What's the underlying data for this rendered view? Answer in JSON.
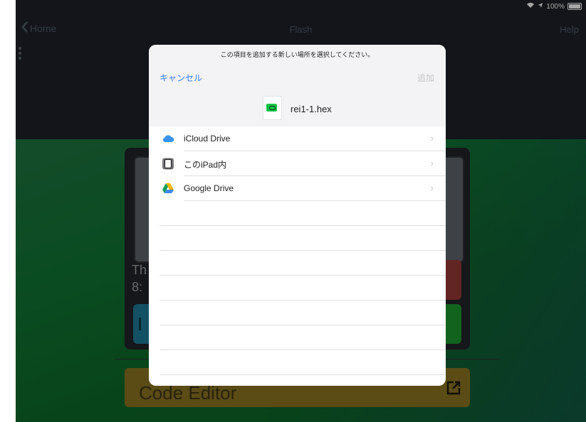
{
  "status_bar": {
    "battery": "100%"
  },
  "nav": {
    "back_label": "Home",
    "title": "Flash",
    "help_label": "Help"
  },
  "device": {
    "line1": "Th",
    "line2": "8:"
  },
  "code_editor": {
    "label": "Code Editor"
  },
  "sheet": {
    "prompt": "この項目を追加する新しい場所を選択してください。",
    "cancel_label": "キャンセル",
    "add_label": "追加",
    "file_name": "rei1-1.hex",
    "locations": [
      {
        "label": "iCloud Drive",
        "icon": "icloud-icon"
      },
      {
        "label": "このiPad内",
        "icon": "ipad-icon"
      },
      {
        "label": "Google Drive",
        "icon": "google-drive-icon"
      }
    ]
  },
  "colors": {
    "accent": "#2e7cf6",
    "code_button": "#7e6a1f",
    "badge_green": "#13c447"
  }
}
